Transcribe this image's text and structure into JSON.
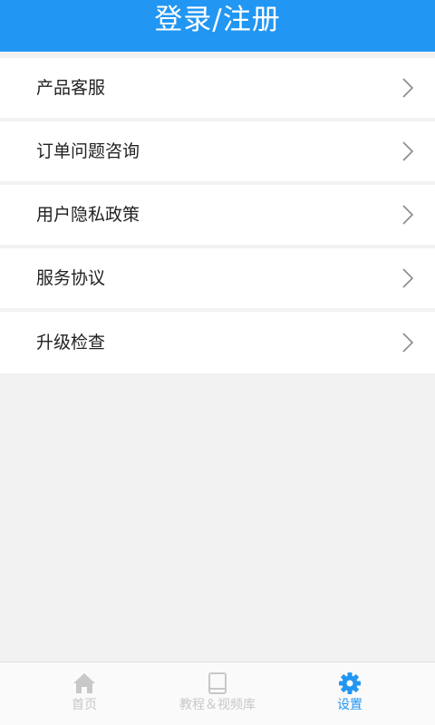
{
  "header": {
    "title": "登录/注册"
  },
  "menu": {
    "items": [
      {
        "label": "产品客服"
      },
      {
        "label": "订单问题咨询"
      },
      {
        "label": "用户隐私政策"
      },
      {
        "label": "服务协议"
      },
      {
        "label": "升级检查"
      }
    ],
    "chevron_icon": "chevron-right-icon"
  },
  "tabbar": {
    "tabs": [
      {
        "label": "首页",
        "icon": "home-icon",
        "active": false
      },
      {
        "label": "教程＆视频库",
        "icon": "book-icon",
        "active": false
      },
      {
        "label": "设置",
        "icon": "gear-icon",
        "active": true
      }
    ]
  },
  "colors": {
    "primary": "#2196f3",
    "background": "#f2f2f2",
    "inactive": "#c8c8c8"
  }
}
